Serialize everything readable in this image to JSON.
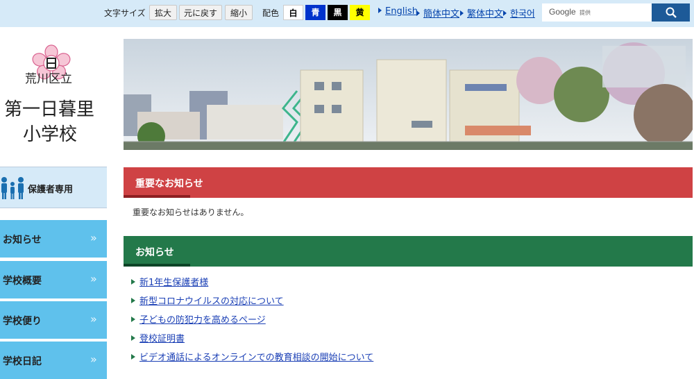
{
  "topbar": {
    "font_size_label": "文字サイズ",
    "enlarge": "拡大",
    "reset": "元に戻す",
    "shrink": "縮小",
    "color_label": "配色",
    "colors": [
      {
        "label": "白",
        "bg": "#ffffff",
        "fg": "#000000"
      },
      {
        "label": "青",
        "bg": "#0033cc",
        "fg": "#ffffff"
      },
      {
        "label": "黒",
        "bg": "#000000",
        "fg": "#ffffff"
      },
      {
        "label": "黄",
        "bg": "#ffff00",
        "fg": "#000000"
      }
    ],
    "languages": [
      "English",
      "簡体中文",
      "繁体中文",
      "한국어"
    ],
    "search_logo": "Google",
    "search_provided": "提供"
  },
  "school": {
    "ward": "荒川区立",
    "name_line1": "第一日暮里",
    "name_line2": "小学校"
  },
  "sidebar": {
    "guardian_label": "保護者専用",
    "items": [
      {
        "label": "お知らせ"
      },
      {
        "label": "学校概要"
      },
      {
        "label": "学校便り"
      },
      {
        "label": "学校日記"
      }
    ],
    "arrow": "»"
  },
  "important": {
    "title": "重要なお知らせ",
    "empty_text": "重要なお知らせはありません。"
  },
  "news": {
    "title": "お知らせ",
    "items": [
      "新1年生保護者様",
      "新型コロナウイルスの対応について",
      "子どもの防犯力を高めるページ",
      "登校証明書",
      "ビデオ通話によるオンラインでの教育相談の開始について"
    ]
  },
  "colors": {
    "accent_red": "#cf4244",
    "accent_green": "#23794a",
    "nav_blue": "#5fc1ec",
    "search_blue": "#1d5a98"
  }
}
